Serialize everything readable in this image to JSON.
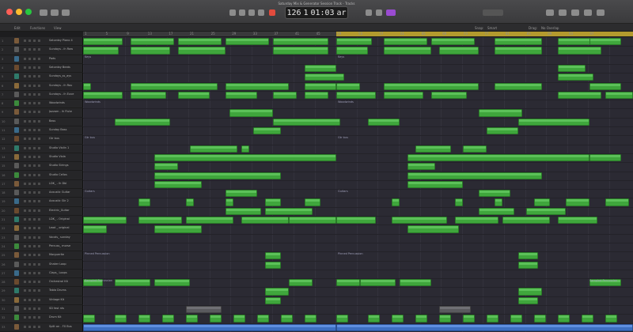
{
  "window": {
    "title": "Saturday Mix & Generator Session Track - Tracks"
  },
  "transport": {
    "lcd_position": "126",
    "lcd_beat": "1",
    "lcd_time": "01:03",
    "lcd_suffix": "ar"
  },
  "toolbar": {
    "edit": "Edit",
    "functions": "Functions",
    "view": "View",
    "snap_label": "Snap:",
    "snap_value": "Smart",
    "drag_label": "Drag:",
    "drag_value": "No Overlap"
  },
  "ruler": {
    "numbers": [
      "1",
      "5",
      "9",
      "13",
      "17",
      "21",
      "25",
      "29",
      "33",
      "37",
      "41",
      "45",
      "49",
      "53",
      "57",
      "61",
      "65",
      "69",
      "73",
      "77",
      "81",
      "85",
      "89",
      "93",
      "97"
    ]
  },
  "tracks": [
    {
      "num": "1",
      "name": "Saturday Piano 4"
    },
    {
      "num": "2",
      "name": "Sundays - ih Raw"
    },
    {
      "num": "3",
      "name": "Pads"
    },
    {
      "num": "4",
      "name": "Saturday Beats"
    },
    {
      "num": "5",
      "name": "Sundays_ss_ays"
    },
    {
      "num": "6",
      "name": "Sundays - ih Rou"
    },
    {
      "num": "7",
      "name": "Sundays - ih Euve"
    },
    {
      "num": "8",
      "name": "Woodwinds"
    },
    {
      "num": "9",
      "name": "Jazzam - ih Flute"
    },
    {
      "num": "10",
      "name": "Bass"
    },
    {
      "num": "11",
      "name": "Sunday Bass"
    },
    {
      "num": "12",
      "name": "Gtr bus"
    },
    {
      "num": "13",
      "name": "Studio Violin 1"
    },
    {
      "num": "14",
      "name": "Studio Viola"
    },
    {
      "num": "15",
      "name": "Studio Strings"
    },
    {
      "num": "16",
      "name": "Studio Cellos"
    },
    {
      "num": "17",
      "name": "LDK_ - ih Dbl"
    },
    {
      "num": "18",
      "name": "Acoustic Guitar"
    },
    {
      "num": "19",
      "name": "Acoustic Gtr 2"
    },
    {
      "num": "20",
      "name": "Electric_Guitar"
    },
    {
      "num": "21",
      "name": "LDK_ - Original"
    },
    {
      "num": "22",
      "name": "Lead _ original"
    },
    {
      "num": "23",
      "name": "Vocals_ sunday"
    },
    {
      "num": "24",
      "name": "Percuss_ morse"
    },
    {
      "num": "25",
      "name": "Marguerite"
    },
    {
      "num": "26",
      "name": "Shaker Loop"
    },
    {
      "num": "27",
      "name": "Claps_ Loops"
    },
    {
      "num": "28",
      "name": "Orchestral Kit"
    },
    {
      "num": "29",
      "name": "Tabla Drums"
    },
    {
      "num": "30",
      "name": "Vintage Kit"
    },
    {
      "num": "31",
      "name": "SD fast nts"
    },
    {
      "num": "32",
      "name": "Drum Kit"
    },
    {
      "num": "33",
      "name": "Split on - FX Bus"
    }
  ],
  "markers": {
    "keys": "Keys",
    "woodwinds": "Woodwinds",
    "gtr_bus": "Gtr bus",
    "guitars": "Guitars",
    "percussion": "Pinned Percussion",
    "sampled": "Sampled Percussion"
  },
  "region_label": "Region"
}
